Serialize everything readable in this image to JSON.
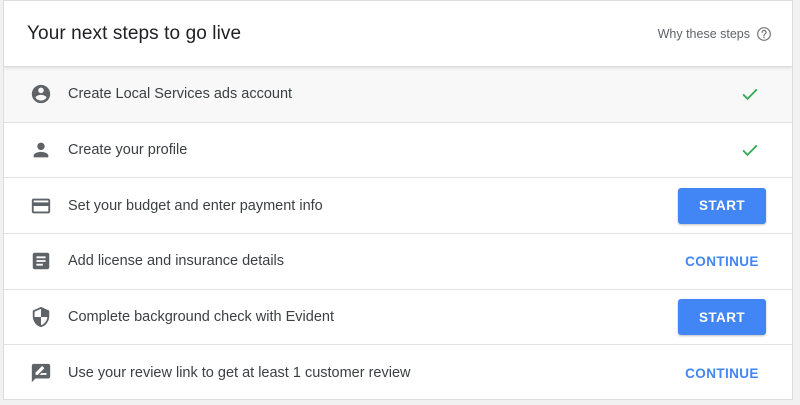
{
  "header": {
    "title": "Your next steps to go live",
    "why_label": "Why these steps"
  },
  "colors": {
    "primary": "#4285f4",
    "check": "#34a853",
    "icon": "#5f6368"
  },
  "steps": [
    {
      "label": "Create Local Services ads account",
      "icon": "account-circle-icon",
      "status": "done"
    },
    {
      "label": "Create your profile",
      "icon": "person-icon",
      "status": "done"
    },
    {
      "label": "Set your budget and enter payment info",
      "icon": "credit-card-icon",
      "status": "todo",
      "action_label": "START"
    },
    {
      "label": "Add license and insurance details",
      "icon": "document-icon",
      "status": "in-progress",
      "action_label": "CONTINUE"
    },
    {
      "label": "Complete background check with Evident",
      "icon": "shield-icon",
      "status": "todo",
      "action_label": "START"
    },
    {
      "label": "Use your review link to get at least 1 customer review",
      "icon": "rate-review-icon",
      "status": "in-progress",
      "action_label": "CONTINUE"
    }
  ]
}
